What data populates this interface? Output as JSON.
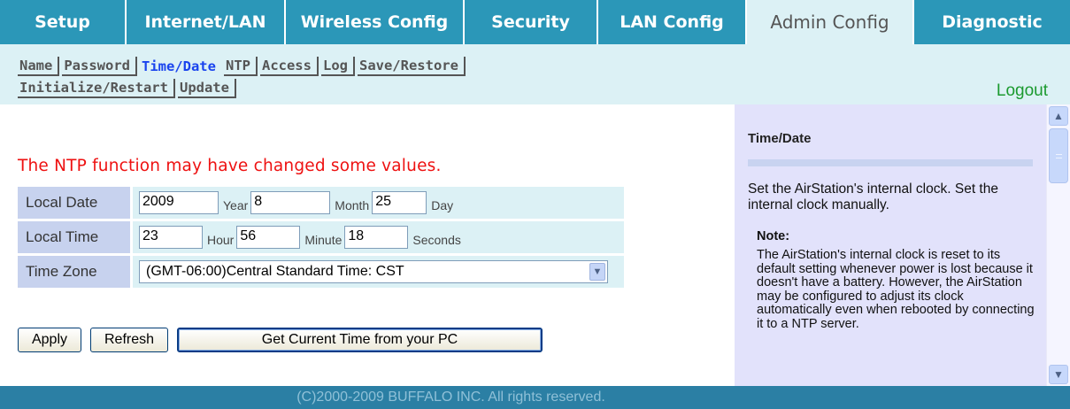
{
  "main_tabs": [
    {
      "label": "Setup",
      "active": false
    },
    {
      "label": "Internet/LAN",
      "active": false
    },
    {
      "label": "Wireless Config",
      "active": false
    },
    {
      "label": "Security",
      "active": false
    },
    {
      "label": "LAN Config",
      "active": false
    },
    {
      "label": "Admin Config",
      "active": true
    },
    {
      "label": "Diagnostic",
      "active": false
    }
  ],
  "sub_nav": {
    "row1": [
      "Name",
      "Password",
      "Time/Date",
      "NTP",
      "Access",
      "Log",
      "Save/Restore"
    ],
    "row2": [
      "Initialize/Restart",
      "Update"
    ],
    "active": "Time/Date"
  },
  "logout_label": "Logout",
  "warning": "The NTP function may have changed some values.",
  "form": {
    "local_date": {
      "label": "Local Date",
      "year": "2009",
      "year_unit": "Year",
      "month": "8",
      "month_unit": "Month",
      "day": "25",
      "day_unit": "Day"
    },
    "local_time": {
      "label": "Local Time",
      "hour": "23",
      "hour_unit": "Hour",
      "minute": "56",
      "minute_unit": "Minute",
      "seconds": "18",
      "seconds_unit": "Seconds"
    },
    "time_zone": {
      "label": "Time Zone",
      "selected": "(GMT-06:00)Central Standard Time: CST"
    }
  },
  "buttons": {
    "apply": "Apply",
    "refresh": "Refresh",
    "get_pc_time": "Get Current Time from your PC"
  },
  "help": {
    "title": "Time/Date",
    "text": "Set the AirStation's internal clock. Set the internal clock manually.",
    "note_title": "Note:",
    "note_text": "The AirStation's internal clock is reset to its default setting whenever power is lost because it doesn't have a battery. However, the AirStation may be configured to adjust its clock automatically even when rebooted by connecting it to a NTP server."
  },
  "footer": "(C)2000-2009 BUFFALO INC. All rights reserved.",
  "colors": {
    "tab_bg": "#2b97b8",
    "active_tab_bg": "#dcf1f5",
    "warning": "#ee1111",
    "active_sub_link": "#1a44ee",
    "logout": "#1b9a2f",
    "help_bg": "#e2e2fb",
    "footer_bg": "#2b7fa4"
  }
}
